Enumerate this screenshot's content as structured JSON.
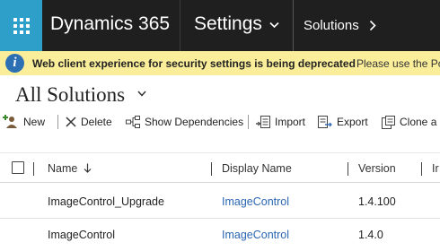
{
  "topbar": {
    "app_name": "Dynamics 365",
    "area": "Settings",
    "breadcrumb": "Solutions"
  },
  "notice": {
    "title": "Web client experience for security settings is being deprecated",
    "message": "Please use the Pow"
  },
  "page": {
    "title": "All Solutions"
  },
  "commands": {
    "new": "New",
    "delete": "Delete",
    "show_dependencies": "Show Dependencies",
    "import": "Import",
    "export": "Export",
    "clone": "Clone a P"
  },
  "grid": {
    "columns": {
      "name": "Name",
      "display_name": "Display Name",
      "version": "Version",
      "installed": "Ir"
    },
    "rows": [
      {
        "name": "ImageControl_Upgrade",
        "display_name": "ImageControl",
        "version": "1.4.100"
      },
      {
        "name": "ImageControl",
        "display_name": "ImageControl",
        "version": "1.4.0"
      }
    ]
  },
  "colors": {
    "topbar": "#1f1f1f",
    "waffle": "#2e9fc9",
    "notice": "#fbee9a",
    "link": "#2b66b2"
  }
}
